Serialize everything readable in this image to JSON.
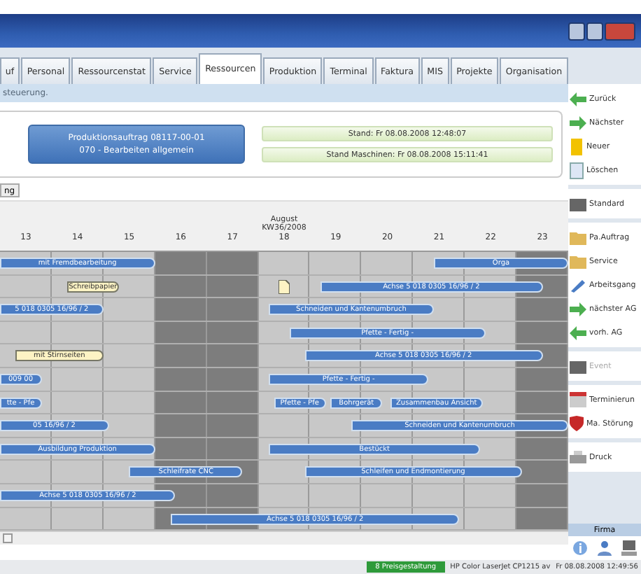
{
  "tabs": [
    {
      "label": "uf",
      "selected": false
    },
    {
      "label": "Personal",
      "selected": false
    },
    {
      "label": "Ressourcenstat",
      "selected": false
    },
    {
      "label": "Service",
      "selected": false
    },
    {
      "label": "Ressourcen",
      "selected": true
    },
    {
      "label": "Produktion",
      "selected": false
    },
    {
      "label": "Terminal",
      "selected": false
    },
    {
      "label": "Faktura",
      "selected": false
    },
    {
      "label": "MIS",
      "selected": false
    },
    {
      "label": "Projekte",
      "selected": false
    },
    {
      "label": "Organisation",
      "selected": false
    }
  ],
  "info_bar": "steuerung.",
  "order_panel": {
    "order_button": [
      "Produktionsauftrag 08117-00-01",
      "070 - Bearbeiten allgemein"
    ],
    "stand": "Stand: Fr 08.08.2008 12:48:07",
    "stand_machines": "Stand Maschinen: Fr 08.08.2008 15:11:41"
  },
  "sub_tab": {
    "label": "ng",
    "selected": true
  },
  "gantt": {
    "month": "August",
    "week": "KW36/2008",
    "days": [
      {
        "label": "13",
        "weekend": false
      },
      {
        "label": "14",
        "weekend": false
      },
      {
        "label": "15",
        "weekend": false
      },
      {
        "label": "16",
        "weekend": true
      },
      {
        "label": "17",
        "weekend": true
      },
      {
        "label": "18",
        "weekend": false
      },
      {
        "label": "19",
        "weekend": false
      },
      {
        "label": "20",
        "weekend": false
      },
      {
        "label": "21",
        "weekend": false
      },
      {
        "label": "22",
        "weekend": false
      },
      {
        "label": "23",
        "weekend": true
      }
    ],
    "rows": [
      {
        "bars": [
          {
            "kind": "bar",
            "label": "mit Fremdbearbeitung"
          },
          {
            "kind": "bar",
            "label": "Orga"
          }
        ]
      },
      {
        "bars": [
          {
            "kind": "note",
            "label": "Schreibpapier"
          },
          {
            "kind": "marker"
          },
          {
            "kind": "bar",
            "label": "Achse 5 018 0305 16/96 / 2"
          }
        ]
      },
      {
        "bars": [
          {
            "kind": "bar",
            "label": "5 018 0305 16/96 / 2"
          },
          {
            "kind": "bar",
            "label": "Schneiden und Kantenumbruch"
          }
        ]
      },
      {
        "bars": [
          {
            "kind": "bar",
            "label": "Pfette - Fertig -"
          }
        ]
      },
      {
        "bars": [
          {
            "kind": "note",
            "label": "mit Stirnseiten"
          },
          {
            "kind": "bar",
            "label": "Achse 5 018 0305 16/96 / 2"
          }
        ]
      },
      {
        "bars": [
          {
            "kind": "bar",
            "label": "009 00"
          },
          {
            "kind": "bar",
            "label": "Pfette - Fertig -"
          }
        ]
      },
      {
        "bars": [
          {
            "kind": "bar",
            "label": "tte - Pfe"
          },
          {
            "kind": "bar",
            "label": "Pfette - Pfe"
          },
          {
            "kind": "bar",
            "label": "Bohrgerät"
          },
          {
            "kind": "bar",
            "label": "Zusammenbau Ansicht"
          }
        ]
      },
      {
        "bars": [
          {
            "kind": "bar",
            "label": "05 16/96 / 2"
          },
          {
            "kind": "bar",
            "label": "Schneiden und Kantenumbruch"
          }
        ]
      },
      {
        "bars": [
          {
            "kind": "bar",
            "label": "Ausbildung Produktion"
          },
          {
            "kind": "bar",
            "label": "Bestückt"
          }
        ]
      },
      {
        "bars": [
          {
            "kind": "bar",
            "label": "Schleifrate CNC"
          },
          {
            "kind": "bar",
            "label": "Schleifen und Endmontierung"
          }
        ]
      },
      {
        "bars": [
          {
            "kind": "bar",
            "label": "Achse 5 018 0305 16/96 / 2"
          }
        ]
      },
      {
        "bars": [
          {
            "kind": "bar",
            "label": "Achse 5 018 0305 16/96 / 2"
          }
        ]
      }
    ]
  },
  "sidebar": {
    "groups": [
      [
        {
          "label": "Zurück",
          "disabled": false
        },
        {
          "label": "Nächster",
          "disabled": false
        },
        {
          "label": "Neuer",
          "disabled": false
        },
        {
          "label": "Löschen",
          "disabled": false
        }
      ],
      [
        {
          "label": "Standard",
          "disabled": false
        }
      ],
      [
        {
          "label": "Pa.Auftrag",
          "disabled": false
        },
        {
          "label": "Service",
          "disabled": false
        },
        {
          "label": "Arbeitsgang",
          "disabled": false
        },
        {
          "label": "nächster AG",
          "disabled": false
        },
        {
          "label": "vorh. AG",
          "disabled": false
        }
      ],
      [
        {
          "label": "Event",
          "disabled": true
        }
      ],
      [
        {
          "label": "Terminierun",
          "disabled": false
        },
        {
          "label": "Ma. Störung",
          "disabled": false
        }
      ],
      [
        {
          "label": "Druck",
          "disabled": false
        }
      ]
    ],
    "footer": "Firma"
  },
  "status_bar": {
    "badge": "8 Preisgestaltung",
    "printer": "HP Color LaserJet CP1215 av",
    "datetime": "Fr 08.08.2008 12:49:56"
  }
}
